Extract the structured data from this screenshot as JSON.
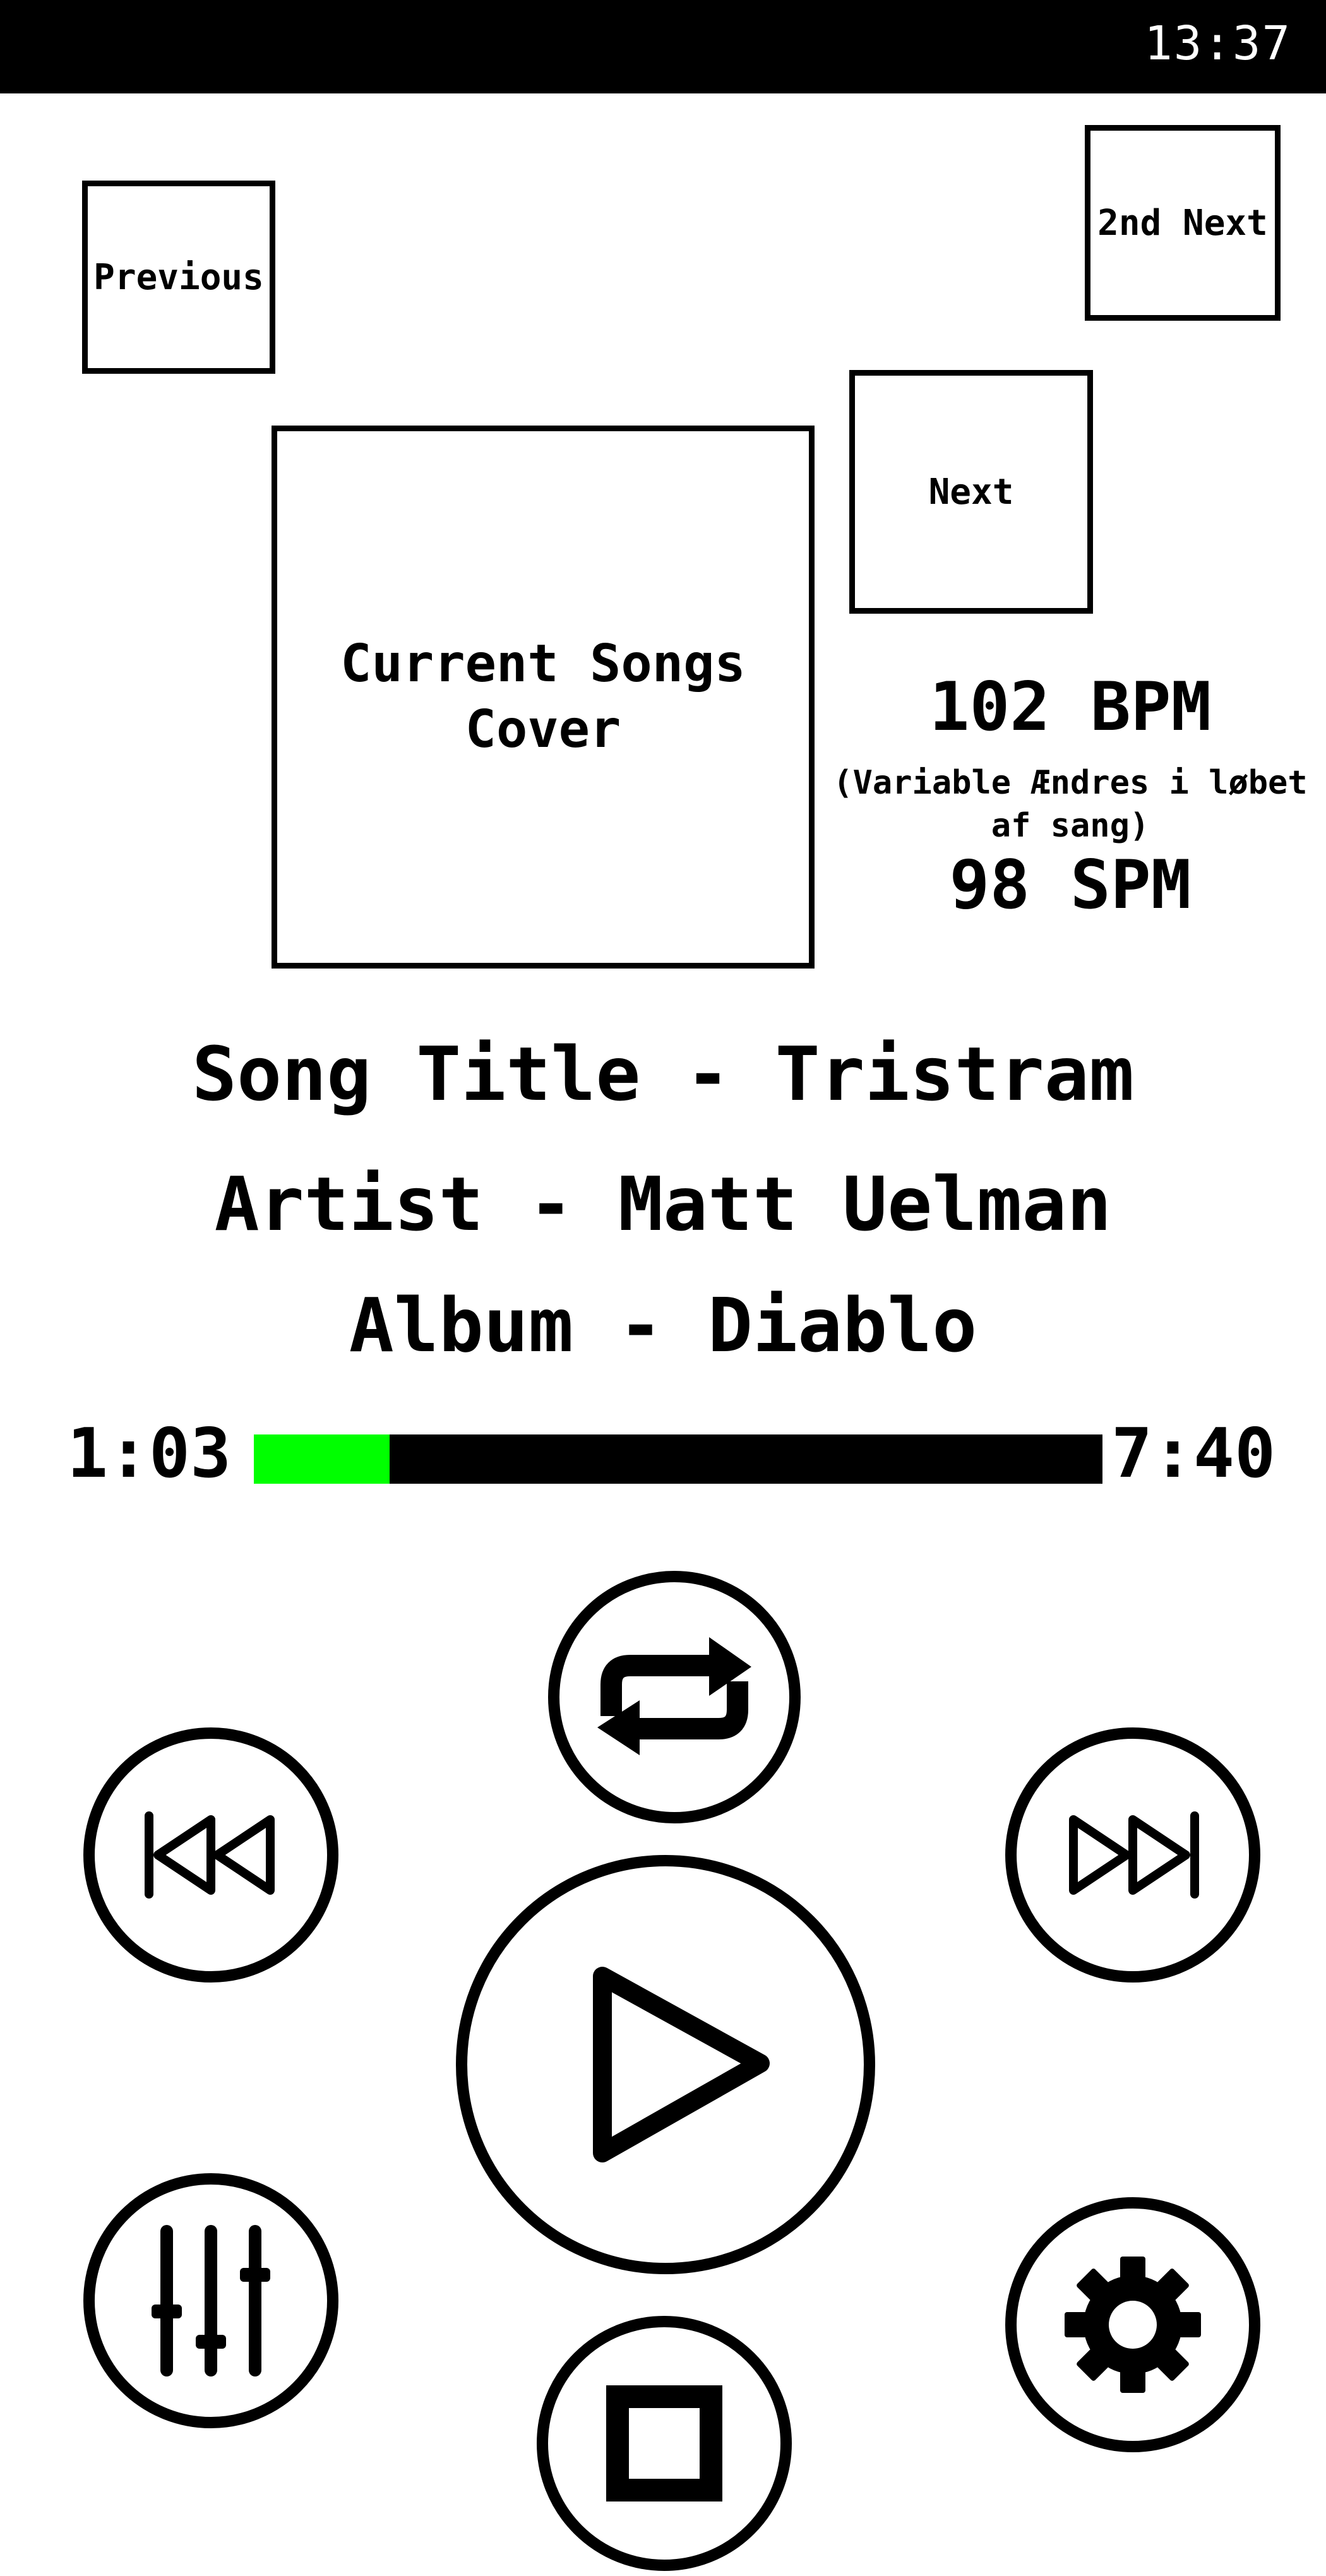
{
  "status_bar": {
    "time": "13:37"
  },
  "queue": {
    "previous_label": "Previous",
    "second_next_label": "2nd Next",
    "next_label": "Next",
    "current_cover_label": "Current Songs Cover"
  },
  "tempo": {
    "bpm": "102 BPM",
    "note": "(Variable Ændres i løbet af sang)",
    "spm": "98 SPM"
  },
  "track": {
    "title_line": "Song Title - Tristram",
    "artist_line": "Artist - Matt Uelman",
    "album_line": "Album - Diablo"
  },
  "progress": {
    "elapsed": "1:03",
    "total": "7:40",
    "fraction": 0.16,
    "fill_color": "#00ff00",
    "track_color": "#000000"
  },
  "controls": {
    "repeat_icon": "repeat-icon",
    "rewind_icon": "skip-back-icon",
    "play_icon": "play-icon",
    "forward_icon": "skip-forward-icon",
    "equalizer_icon": "equalizer-sliders-icon",
    "stop_icon": "stop-icon",
    "settings_icon": "gear-icon"
  }
}
